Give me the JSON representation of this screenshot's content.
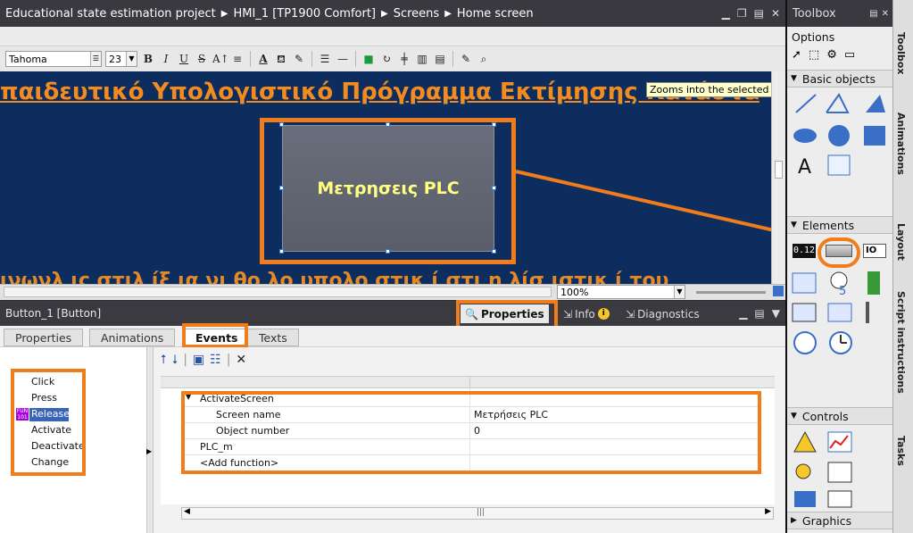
{
  "titlebar": {
    "crumbs": [
      "Educational state estimation project",
      "HMI_1 [TP1900 Comfort]",
      "Screens",
      "Home screen"
    ]
  },
  "format_toolbar": {
    "font_name": "Tahoma",
    "font_size": "23",
    "buttons": [
      "B",
      "I",
      "U",
      "S",
      "A"
    ]
  },
  "canvas": {
    "title_text": "παιδευτικό Υπολογιστικό Πρόγραμμα Εκτίμησης Κατάστα",
    "subtitle_text": "ινωνλ ις στιλ ίξ  ια νι θο λο υπολο στικ ί στι η λίσ  ιστικ ί του",
    "button_label": "Μετρησεις PLC",
    "tooltip": "Zooms into the selected area.",
    "zoom": "100%"
  },
  "inspector": {
    "title": "Button_1 [Button]",
    "tabs_right": [
      "Properties",
      "Info",
      "Diagnostics"
    ],
    "tabs": [
      "Properties",
      "Animations",
      "Events",
      "Texts"
    ],
    "events": [
      "Click",
      "Press",
      "Release",
      "Activate",
      "Deactivate",
      "Change"
    ],
    "selected_event": "Release",
    "function_rows": [
      {
        "name": "ActivateScreen",
        "value": ""
      },
      {
        "name": "Screen name",
        "value": "Μετρήσεις PLC"
      },
      {
        "name": "Object number",
        "value": "0"
      },
      {
        "name": "PLC_m",
        "value": ""
      },
      {
        "name": "<Add function>",
        "value": ""
      }
    ]
  },
  "toolbox": {
    "title": "Toolbox",
    "options_label": "Options",
    "sections": [
      "Basic objects",
      "Elements",
      "Controls",
      "Graphics"
    ],
    "element_value": "0.12",
    "element_io": "IO"
  },
  "vertical_tabs": [
    "Toolbox",
    "Animations",
    "Layout",
    "Script instructions",
    "Tasks"
  ],
  "colors": {
    "highlight": "#f07c1c",
    "canvas_bg": "#0c2d5e",
    "title_orange": "#f38b1e",
    "button_text": "#ffff80"
  }
}
